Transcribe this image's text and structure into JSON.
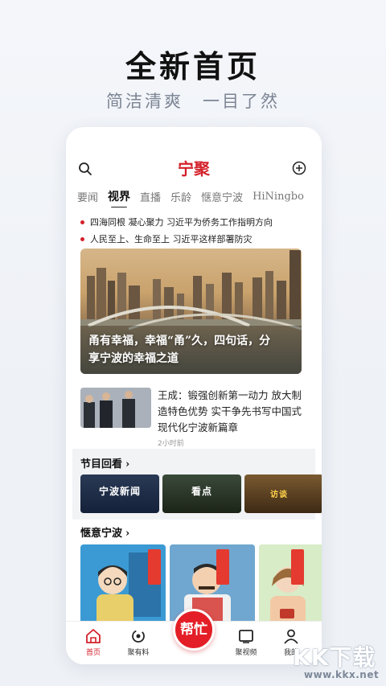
{
  "promo": {
    "title": "全新首页",
    "subtitle": "简洁清爽　一目了然"
  },
  "app": {
    "brand": "宁聚",
    "search_icon": "search-icon",
    "add_icon": "plus-circle-icon"
  },
  "tabs": [
    {
      "label": "要闻",
      "active": false
    },
    {
      "label": "视界",
      "active": true
    },
    {
      "label": "直播",
      "active": false
    },
    {
      "label": "乐龄",
      "active": false
    },
    {
      "label": "惬意宁波",
      "active": false
    },
    {
      "label": "HiNingbo",
      "active": false
    }
  ],
  "headlines": [
    "四海同根 凝心聚力 习近平为侨务工作指明方向",
    "人民至上、生命至上 习近平这样部署防灾"
  ],
  "hero": {
    "caption_line1": "甬有幸福，幸福“甬”久，四句话，分",
    "caption_line2": "享宁波的幸福之道"
  },
  "news": {
    "title": "王成：锻强创新第一动力 放大制造特色优势 实干争先书写中国式现代化宁波新篇章",
    "time": "2小时前"
  },
  "sections": {
    "programs_title": "节目回看",
    "leisure_title": "惬意宁波",
    "chevron": "›"
  },
  "programs": [
    {
      "label": "宁波新闻"
    },
    {
      "label": "看点"
    },
    {
      "label": "访谈"
    }
  ],
  "bottom_nav": {
    "home": "首页",
    "tips": "聚有料",
    "help": "帮忙",
    "video": "聚视频",
    "mine": "我的"
  },
  "watermark": {
    "logo": "KK下载",
    "url": "www.kkx.net"
  },
  "colors": {
    "accent": "#d4202a",
    "help_button": "#e41e26"
  }
}
